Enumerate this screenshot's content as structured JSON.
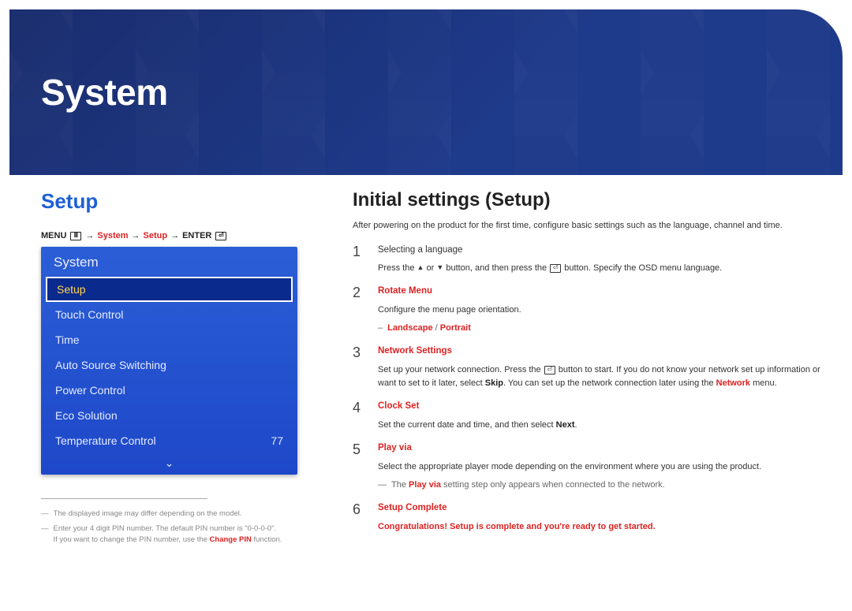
{
  "banner": {
    "title": "System"
  },
  "left": {
    "setup_title": "Setup",
    "breadcrumb": {
      "menu_label": "MENU",
      "nav1": "System",
      "nav2": "Setup",
      "enter_label": "ENTER"
    },
    "panel": {
      "title": "System",
      "items": [
        {
          "label": "Setup"
        },
        {
          "label": "Touch Control"
        },
        {
          "label": "Time"
        },
        {
          "label": "Auto Source Switching"
        },
        {
          "label": "Power Control"
        },
        {
          "label": "Eco Solution"
        },
        {
          "label": "Temperature Control",
          "value": "77"
        }
      ]
    },
    "footnotes": {
      "n1": "The displayed image may differ depending on the model.",
      "n2a": "Enter your 4 digit PIN number. The default PIN number is \"0-0-0-0\".",
      "n2b_prefix": "If you want to change the PIN number, use the ",
      "n2b_red": "Change PIN",
      "n2b_suffix": " function."
    }
  },
  "right": {
    "title": "Initial settings (Setup)",
    "intro": "After powering on the product for the first time, configure basic settings such as the language, channel and time.",
    "step1": {
      "num": "1",
      "title": "Selecting a language",
      "body_pre": "Press the ",
      "body_mid": " button, and then press the ",
      "body_post": " button. Specify the OSD menu language.",
      "or": " or "
    },
    "step2": {
      "num": "2",
      "title": "Rotate Menu",
      "body": "Configure the menu page orientation.",
      "opt1": "Landscape",
      "sep": " / ",
      "opt2": "Portrait"
    },
    "step3": {
      "num": "3",
      "title": "Network Settings",
      "body_pre": "Set up your network connection. Press the ",
      "body_mid": " button to start. If you do not know your network set up information or want to set to it later, select ",
      "skip": "Skip",
      "body_mid2": ". You can set up the network connection later using the ",
      "network": "Network",
      "body_post": " menu."
    },
    "step4": {
      "num": "4",
      "title": "Clock Set",
      "body_pre": "Set the current date and time, and then select ",
      "next": "Next",
      "body_post": "."
    },
    "step5": {
      "num": "5",
      "title": "Play via",
      "body": "Select the appropriate player mode depending on the environment where you are using the product.",
      "note_pre": "The ",
      "note_red": "Play via",
      "note_post": " setting step only appears when connected to the network."
    },
    "step6": {
      "num": "6",
      "title": "Setup Complete",
      "body": "Congratulations! Setup is complete and you're ready to get started."
    }
  }
}
